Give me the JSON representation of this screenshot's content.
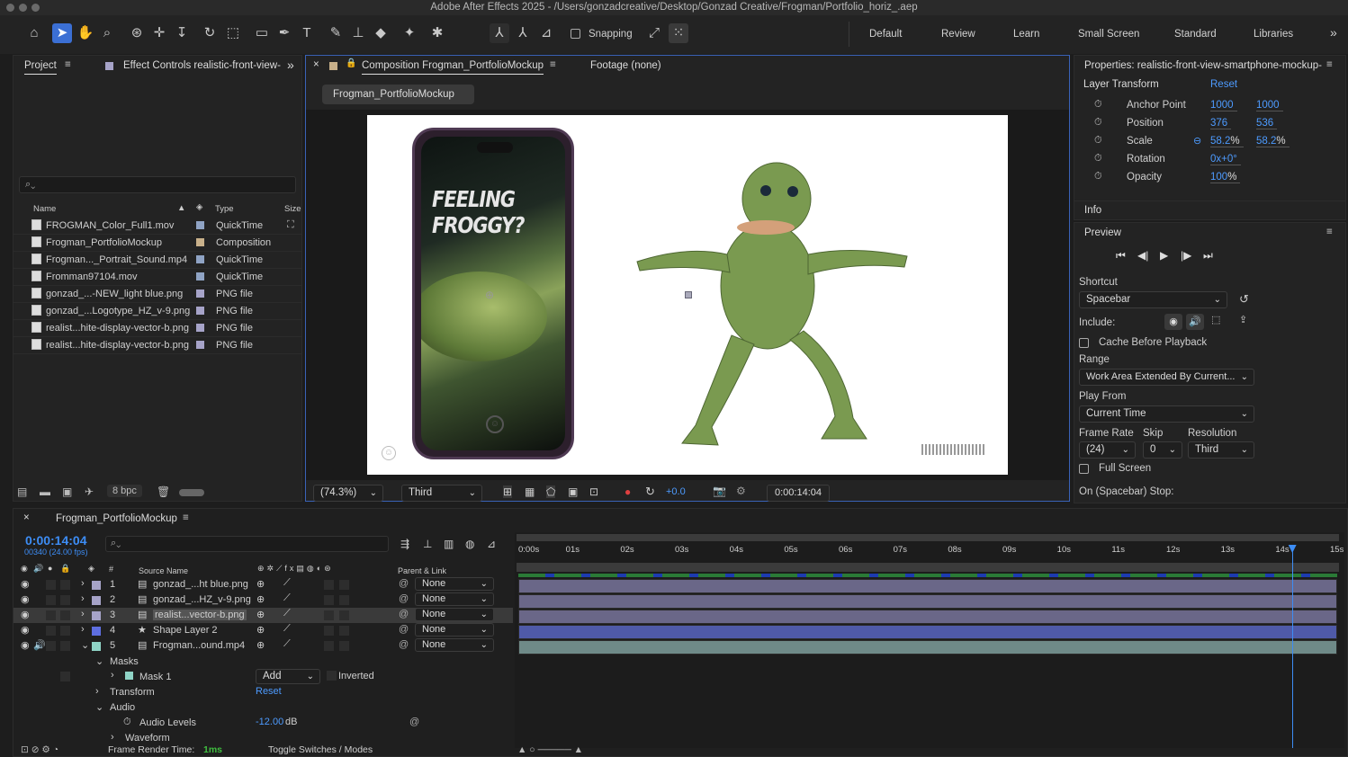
{
  "app": {
    "title": "Adobe After Effects 2025 - /Users/gonzadcreative/Desktop/Gonzad Creative/Frogman/Portfolio_horiz_.aep"
  },
  "toolbar": {
    "snapping_label": "Snapping",
    "workspaces": [
      "Default",
      "Review",
      "Learn",
      "Small Screen",
      "Standard",
      "Libraries"
    ]
  },
  "project": {
    "tab_label": "Project",
    "effect_controls_label": "Effect Controls realistic-front-view-s",
    "columns": {
      "name": "Name",
      "type": "Type",
      "size": "Size"
    },
    "items": [
      {
        "name": "FROGMAN_Color_Full1.mov",
        "type": "QuickTime",
        "color": "#8fa3c4"
      },
      {
        "name": "Frogman_PortfolioMockup",
        "type": "Composition",
        "color": "#c8b08a"
      },
      {
        "name": "Frogman..._Portrait_Sound.mp4",
        "type": "QuickTime",
        "color": "#8fa3c4"
      },
      {
        "name": "Fromman97104.mov",
        "type": "QuickTime",
        "color": "#8fa3c4"
      },
      {
        "name": "gonzad_...-NEW_light blue.png",
        "type": "PNG file",
        "color": "#a6a3c8"
      },
      {
        "name": "gonzad_...Logotype_HZ_v-9.png",
        "type": "PNG file",
        "color": "#a6a3c8"
      },
      {
        "name": "realist...hite-display-vector-b.png",
        "type": "PNG file",
        "color": "#a6a3c8"
      },
      {
        "name": "realist...hite-display-vector-b.png",
        "type": "PNG file",
        "color": "#a6a3c8"
      }
    ],
    "bpc_label": "8 bpc"
  },
  "composition": {
    "tab_label": "Composition Frogman_PortfolioMockup",
    "footage_label": "Footage (none)",
    "breadcrumb": "Frogman_PortfolioMockup",
    "phone_text": "FEELING FROGGY?",
    "zoom": "(74.3%)",
    "resolution": "Third",
    "exposure": "+0.0",
    "timecode": "0:00:14:04"
  },
  "properties": {
    "title": "Properties: realistic-front-view-smartphone-mockup-m",
    "section": "Layer Transform",
    "reset": "Reset",
    "rows": [
      {
        "label": "Anchor Point",
        "v1": "1000",
        "v2": "1000"
      },
      {
        "label": "Position",
        "v1": "376",
        "v2": "536"
      },
      {
        "label": "Scale",
        "v1": "58.2",
        "v1_unit": "%",
        "v2": "58.2",
        "v2_unit": "%"
      },
      {
        "label": "Rotation",
        "v1": "0x+0°",
        "v2": ""
      },
      {
        "label": "Opacity",
        "v1": "100",
        "v1_unit": "%",
        "v2": ""
      }
    ],
    "info_label": "Info"
  },
  "preview": {
    "title": "Preview",
    "shortcut_label": "Shortcut",
    "shortcut_value": "Spacebar",
    "include_label": "Include:",
    "cache_label": "Cache Before Playback",
    "range_label": "Range",
    "range_value": "Work Area Extended By Current...",
    "play_from_label": "Play From",
    "play_from_value": "Current Time",
    "frame_rate_label": "Frame Rate",
    "frame_rate_value": "(24)",
    "skip_label": "Skip",
    "skip_value": "0",
    "resolution_label": "Resolution",
    "resolution_value": "Third",
    "full_screen_label": "Full Screen",
    "stop_label": "On (Spacebar) Stop:"
  },
  "timeline": {
    "comp_name": "Frogman_PortfolioMockup",
    "timecode": "0:00:14:04",
    "frame_info": "00340 (24.00 fps)",
    "col_source": "Source Name",
    "col_parent": "Parent & Link",
    "ruler": [
      "0:00s",
      "01s",
      "02s",
      "03s",
      "04s",
      "05s",
      "06s",
      "07s",
      "08s",
      "09s",
      "10s",
      "11s",
      "12s",
      "13s",
      "14s",
      "15s"
    ],
    "playhead_seconds": 14.17,
    "duration_seconds": 15,
    "layers": [
      {
        "num": "1",
        "name": "gonzad_...ht blue.png",
        "parent": "None",
        "color": "#a6a3c8"
      },
      {
        "num": "2",
        "name": "gonzad_...HZ_v-9.png",
        "parent": "None",
        "color": "#a6a3c8"
      },
      {
        "num": "3",
        "name": "realist...vector-b.png",
        "parent": "None",
        "color": "#a6a3c8"
      },
      {
        "num": "4",
        "name": "Shape Layer 2",
        "parent": "None",
        "color": "#5e6ee0"
      },
      {
        "num": "5",
        "name": "Frogman...ound.mp4",
        "parent": "None",
        "color": "#8fd4c6"
      }
    ],
    "sub": {
      "masks": "Masks",
      "mask1": "Mask 1",
      "mask_mode": "Add",
      "inverted": "Inverted",
      "transform": "Transform",
      "transform_reset": "Reset",
      "audio": "Audio",
      "audio_levels": "Audio Levels",
      "audio_value": "-12.00",
      "audio_unit": "dB",
      "waveform": "Waveform"
    },
    "footer": {
      "render_label": "Frame Render Time:",
      "render_value": "1ms",
      "toggle": "Toggle Switches / Modes"
    }
  },
  "colors": {
    "accent": "#3b6fd4",
    "link_blue": "#4d9bff",
    "timecode_blue": "#3d8df5"
  }
}
